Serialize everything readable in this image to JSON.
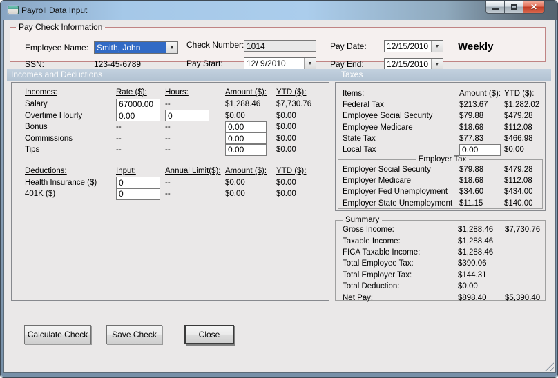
{
  "window": {
    "title": "Payroll Data Input"
  },
  "paycheck": {
    "legend": "Pay Check Information",
    "employee_name": {
      "label": "Employee Name:",
      "value": "Smith, John"
    },
    "ssn": {
      "label": "SSN:",
      "value": "123-45-6789"
    },
    "check_number": {
      "label": "Check Number:",
      "value": "1014"
    },
    "pay_start": {
      "label": "Pay Start:",
      "value": "12/ 9/2010"
    },
    "pay_date": {
      "label": "Pay Date:",
      "value": "12/15/2010"
    },
    "pay_end": {
      "label": "Pay End:",
      "value": "12/15/2010"
    },
    "frequency": "Weekly"
  },
  "section_headers": {
    "left": "Incomes and Deductions",
    "right": "Taxes"
  },
  "incomes": {
    "headers": {
      "item": "Incomes:",
      "rate": "Rate ($):",
      "hours": "Hours:",
      "amount": "Amount ($):",
      "ytd": "YTD ($):"
    },
    "rows": [
      {
        "label": "Salary",
        "rate": "67000.00",
        "hours": "--",
        "amount": "$1,288.46",
        "ytd": "$7,730.76"
      },
      {
        "label": "Overtime Hourly",
        "rate": "0.00",
        "hours": "0",
        "amount": "$0.00",
        "ytd": "$0.00"
      },
      {
        "label": "Bonus",
        "rate": "--",
        "hours": "--",
        "amount": "0.00",
        "ytd": "$0.00"
      },
      {
        "label": "Commissions",
        "rate": "--",
        "hours": "--",
        "amount": "0.00",
        "ytd": "$0.00"
      },
      {
        "label": "Tips",
        "rate": "--",
        "hours": "--",
        "amount": "0.00",
        "ytd": "$0.00"
      }
    ]
  },
  "deductions": {
    "headers": {
      "item": "Deductions:",
      "input": "Input:",
      "limit": "Annual Limit($):",
      "amount": "Amount ($):",
      "ytd": "YTD ($):"
    },
    "rows": [
      {
        "label": "Health Insurance  ($)",
        "input": "0",
        "limit": "--",
        "amount": "$0.00",
        "ytd": "$0.00"
      },
      {
        "label": "401K  ($)",
        "input": "0",
        "limit": "--",
        "amount": "$0.00",
        "ytd": "$0.00"
      }
    ]
  },
  "taxes": {
    "headers": {
      "item": "Items:",
      "amount": "Amount ($):",
      "ytd": "YTD ($):"
    },
    "rows": [
      {
        "label": "Federal Tax",
        "amount": "$213.67",
        "ytd": "$1,282.02"
      },
      {
        "label": "Employee Social Security",
        "amount": "$79.88",
        "ytd": "$479.28"
      },
      {
        "label": "Employee Medicare",
        "amount": "$18.68",
        "ytd": "$112.08"
      },
      {
        "label": "State Tax",
        "amount": "$77.83",
        "ytd": "$466.98"
      },
      {
        "label": "Local Tax",
        "amount": "0.00",
        "ytd": "$0.00"
      }
    ],
    "employer": {
      "title": "Employer Tax",
      "rows": [
        {
          "label": "Employer Social Security",
          "amount": "$79.88",
          "ytd": "$479.28"
        },
        {
          "label": "Employer Medicare",
          "amount": "$18.68",
          "ytd": "$112.08"
        },
        {
          "label": "Employer Fed Unemployment",
          "amount": "$34.60",
          "ytd": "$434.00"
        },
        {
          "label": "Employer State Unemployment",
          "amount": "$11.15",
          "ytd": "$140.00"
        }
      ]
    }
  },
  "summary": {
    "legend": "Summary",
    "rows": [
      {
        "label": "Gross Income:",
        "amount": "$1,288.46",
        "ytd": "$7,730.76"
      },
      {
        "label": "Taxable Income:",
        "amount": "$1,288.46",
        "ytd": ""
      },
      {
        "label": "FICA Taxable Income:",
        "amount": "$1,288.46",
        "ytd": ""
      },
      {
        "label": "Total Employee Tax:",
        "amount": "$390.06",
        "ytd": ""
      },
      {
        "label": "Total Employer Tax:",
        "amount": "$144.31",
        "ytd": ""
      },
      {
        "label": "Total Deduction:",
        "amount": "$0.00",
        "ytd": ""
      },
      {
        "label": "Net Pay:",
        "amount": "$898.40",
        "ytd": "$5,390.40"
      }
    ]
  },
  "buttons": {
    "calculate": "Calculate Check",
    "save": "Save Check",
    "close": "Close"
  },
  "icons": {
    "dropdown": "▼",
    "close": "✕"
  },
  "colors": {
    "section_header_bg": "#b5c4d4",
    "paycheck_border": "#c08484",
    "selection_blue": "#316ac5",
    "close_button_red": "#c8402b",
    "titlebar_glass": "#a5c8e8"
  }
}
